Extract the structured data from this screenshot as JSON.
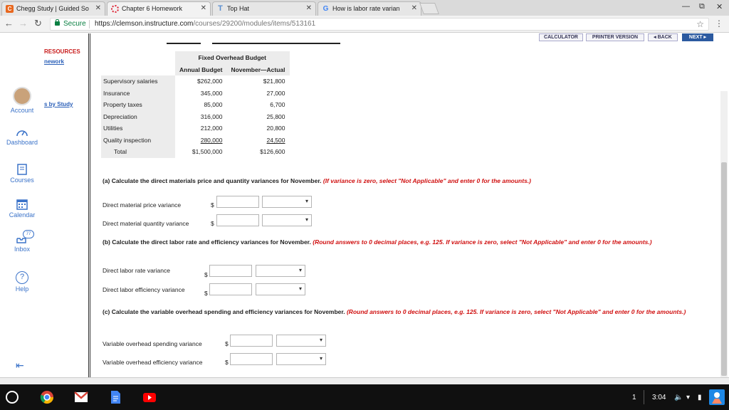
{
  "browser": {
    "tabs": [
      {
        "title": "Chegg Study | Guided So",
        "fav": "C",
        "color": "#e8671e"
      },
      {
        "title": "Chapter 6 Homework",
        "fav": "",
        "color": "#d23"
      },
      {
        "title": "Top Hat",
        "fav": "T",
        "color": "#5b8fd0"
      },
      {
        "title": "How is labor rate varian",
        "fav": "G",
        "color": "#4285f4"
      }
    ],
    "secure_label": "Secure",
    "url_host": "https://clemson.instructure.com",
    "url_path": "/courses/29200/modules/items/513161"
  },
  "global_nav": {
    "account": "Account",
    "dashboard": "Dashboard",
    "courses": "Courses",
    "calendar": "Calendar",
    "inbox": "Inbox",
    "inbox_badge": "77",
    "help": "Help"
  },
  "course_nav": {
    "resources": "RESOURCES",
    "homework": "nework",
    "study": "s by Study"
  },
  "toolbar": {
    "calculator": "CALCULATOR",
    "printer": "PRINTER VERSION",
    "back": "◂ BACK",
    "next": "NEXT ▸"
  },
  "budget": {
    "title": "Fixed Overhead Budget",
    "col1": "Annual Budget",
    "col2": "November—Actual",
    "rows": [
      {
        "label": "Supervisory salaries",
        "annual": "$262,000",
        "actual": "$21,800"
      },
      {
        "label": "Insurance",
        "annual": "345,000",
        "actual": "27,000"
      },
      {
        "label": "Property taxes",
        "annual": "85,000",
        "actual": "6,700"
      },
      {
        "label": "Depreciation",
        "annual": "316,000",
        "actual": "25,800"
      },
      {
        "label": "Utilities",
        "annual": "212,000",
        "actual": "20,800"
      },
      {
        "label": "Quality inspection",
        "annual": "280,000",
        "actual": "24,500"
      }
    ],
    "total": {
      "label": "Total",
      "annual": "$1,500,000",
      "actual": "$126,600"
    }
  },
  "questions": {
    "a_text": "(a) Calculate the direct materials price and quantity variances for November.",
    "a_note": "(If variance is zero, select \"Not Applicable\" and enter 0 for the amounts.)",
    "a1": "Direct material price variance",
    "a2": "Direct material quantity variance",
    "b_text": "(b) Calculate the direct labor rate and efficiency variances for November.",
    "b_note": "(Round answers to 0 decimal places, e.g. 125. If variance is zero, select \"Not Applicable\" and enter 0 for the amounts.)",
    "b1": "Direct labor rate variance",
    "b2": "Direct labor efficiency variance",
    "c_text": "(c) Calculate the variable overhead spending and efficiency variances for November.",
    "c_note": "(Round answers to 0 decimal places, e.g. 125. If variance is zero, select \"Not Applicable\" and enter 0 for the amounts.)",
    "c1": "Variable overhead spending variance",
    "c2": "Variable overhead efficiency variance",
    "currency": "$"
  },
  "shelf": {
    "notification_count": "1",
    "time": "3:04"
  }
}
